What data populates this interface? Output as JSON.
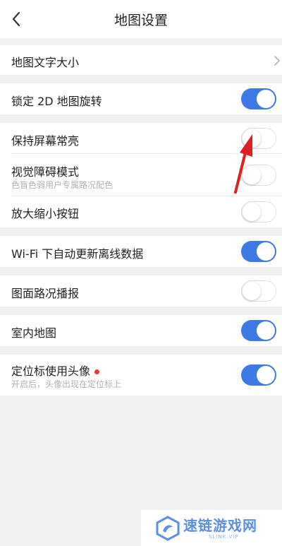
{
  "header": {
    "title": "地图设置",
    "back_icon": "chevron-left-icon"
  },
  "settings": {
    "text_size": {
      "label": "地图文字大小",
      "icon": "chevron-right-icon"
    },
    "lock_2d": {
      "label": "锁定 2D 地图旋转",
      "enabled": true
    },
    "keep_screen_on": {
      "label": "保持屏幕常亮",
      "enabled": false
    },
    "visual_impairment": {
      "label": "视觉障碍模式",
      "subtitle": "色盲色弱用户专属路况配色",
      "enabled": false
    },
    "zoom_buttons": {
      "label": "放大缩小按钮",
      "enabled": false
    },
    "wifi_update": {
      "label": "Wi-Fi 下自动更新离线数据",
      "enabled": true
    },
    "traffic_broadcast": {
      "label": "图面路况播报",
      "enabled": false
    },
    "indoor_map": {
      "label": "室内地图",
      "enabled": true
    },
    "avatar_marker": {
      "label": "定位标使用头像",
      "subtitle": "开启后，头像出现在定位标上",
      "enabled": true
    }
  },
  "watermark": {
    "brand": "速链游戏网",
    "url": "SLINK.VIP"
  },
  "colors": {
    "toggle_on": "#3d7ae6",
    "annotation_arrow": "#e02020",
    "new_dot": "#e53935",
    "background": "#f0f0f0"
  }
}
